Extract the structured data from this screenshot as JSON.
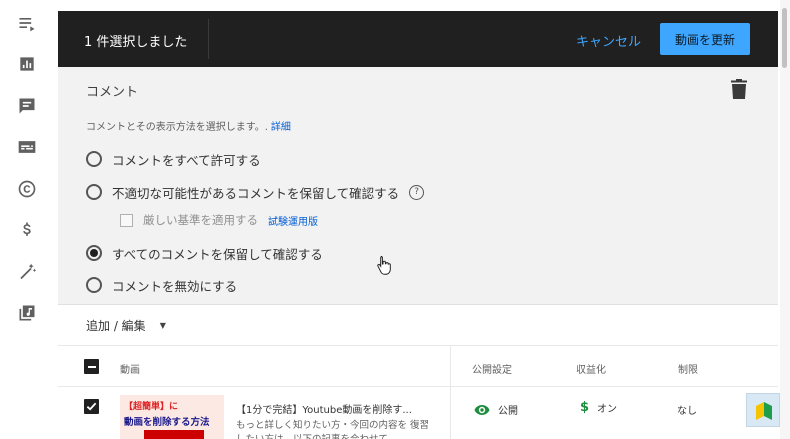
{
  "header": {
    "selection_text": "1 件選択しました",
    "cancel_label": "キャンセル",
    "update_label": "動画を更新"
  },
  "comments_panel": {
    "title": "コメント",
    "description": "コメントとその表示方法を選択します。.",
    "details_link": "詳細",
    "options": [
      {
        "label": "コメントをすべて許可する",
        "selected": false
      },
      {
        "label": "不適切な可能性があるコメントを保留して確認する",
        "selected": false
      },
      {
        "label": "すべてのコメントを保留して確認する",
        "selected": true
      },
      {
        "label": "コメントを無効にする",
        "selected": false
      }
    ],
    "strict_label": "厳しい基準を適用する",
    "beta_label": "試験運用版"
  },
  "toolbar": {
    "add_edit_label": "追加 / 編集"
  },
  "table": {
    "headers": {
      "video": "動画",
      "visibility": "公開設定",
      "monetization": "収益化",
      "restrictions": "制限"
    },
    "row": {
      "thumbnail_line1": "【超簡単】に",
      "thumbnail_line2": "動画を削除する方法",
      "title": "【1分で完結】Youtube動画を削除す...",
      "description": "もっと詳しく知りたい方・今回の内容を 復習したい方は、以下の記事を合わせて",
      "visibility": "公開",
      "monetization": "オン",
      "restrictions": "なし"
    }
  },
  "colors": {
    "accent": "#3ea6ff",
    "topbar": "#202020",
    "panel_bg": "#f2f2f2",
    "monetization_green": "#1e8e3e"
  },
  "icons": [
    "list-icon",
    "analytics-icon",
    "comments-icon",
    "subtitles-icon",
    "copyright-icon",
    "monetization-icon",
    "customization-icon",
    "audio-library-icon",
    "trash-icon",
    "help-icon",
    "eye-icon",
    "dollar-icon",
    "dropdown-caret-icon"
  ]
}
